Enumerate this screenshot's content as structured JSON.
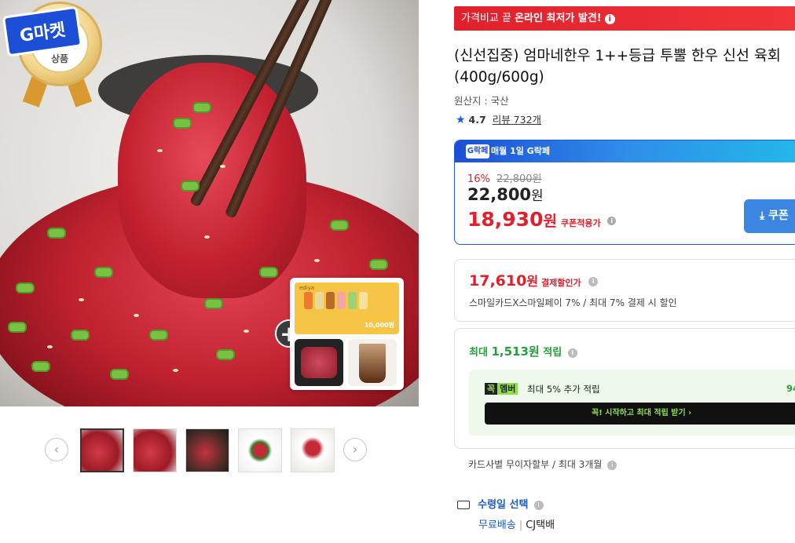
{
  "badge": {
    "logo_text": "G마켓",
    "medal_text": "상품"
  },
  "gift": {
    "brand": "ediya",
    "price": "10,000원"
  },
  "banner": {
    "prefix": "가격비교 끝 ",
    "highlight": "온라인 최저가 발견!",
    "icon": "info-icon"
  },
  "product": {
    "title": "(신선집중) 엄마네한우 1++등급 투뿔 한우 신선 육회 (400g/600g)",
    "origin": "원산지 : 국산",
    "rating": "4.7",
    "review": "리뷰 732개"
  },
  "price_box": {
    "header": "매월 1일 G락페",
    "logo": "G락페",
    "discount_pct": "16%",
    "original": "22,800원",
    "sale_price": "22,800",
    "sale_won": "원",
    "coupon_price": "18,930",
    "coupon_won": "원",
    "coupon_tag": "쿠폰적용가",
    "coupon_button": "쿠폰"
  },
  "pay_box": {
    "price": "17,610",
    "won": "원",
    "label": "결제할인가",
    "desc": "스마일카드X스마일페이 7% / 최대 7% 결제 시 할인"
  },
  "point_box": {
    "prefix": "최대 ",
    "amount": "1,513원",
    "suffix": " 적립",
    "member_kk": "꼭",
    "member_mb": "멤버",
    "member_text": "최대 5% 추가 적립",
    "member_value": "94",
    "cta": "꼭! 시작하고 최대 적립 받기  ›"
  },
  "install": "카드사별 무이자할부 / 최대 3개월",
  "delivery": {
    "label": "수령일 선택",
    "free": "무료배송",
    "sep": "|",
    "carrier": "CJ택배"
  },
  "thumbs": {
    "prev": "‹",
    "next": "›"
  },
  "colors": {
    "accent_red": "#e0202c",
    "accent_blue": "#1c5bd6",
    "green": "#2a9d3f"
  }
}
